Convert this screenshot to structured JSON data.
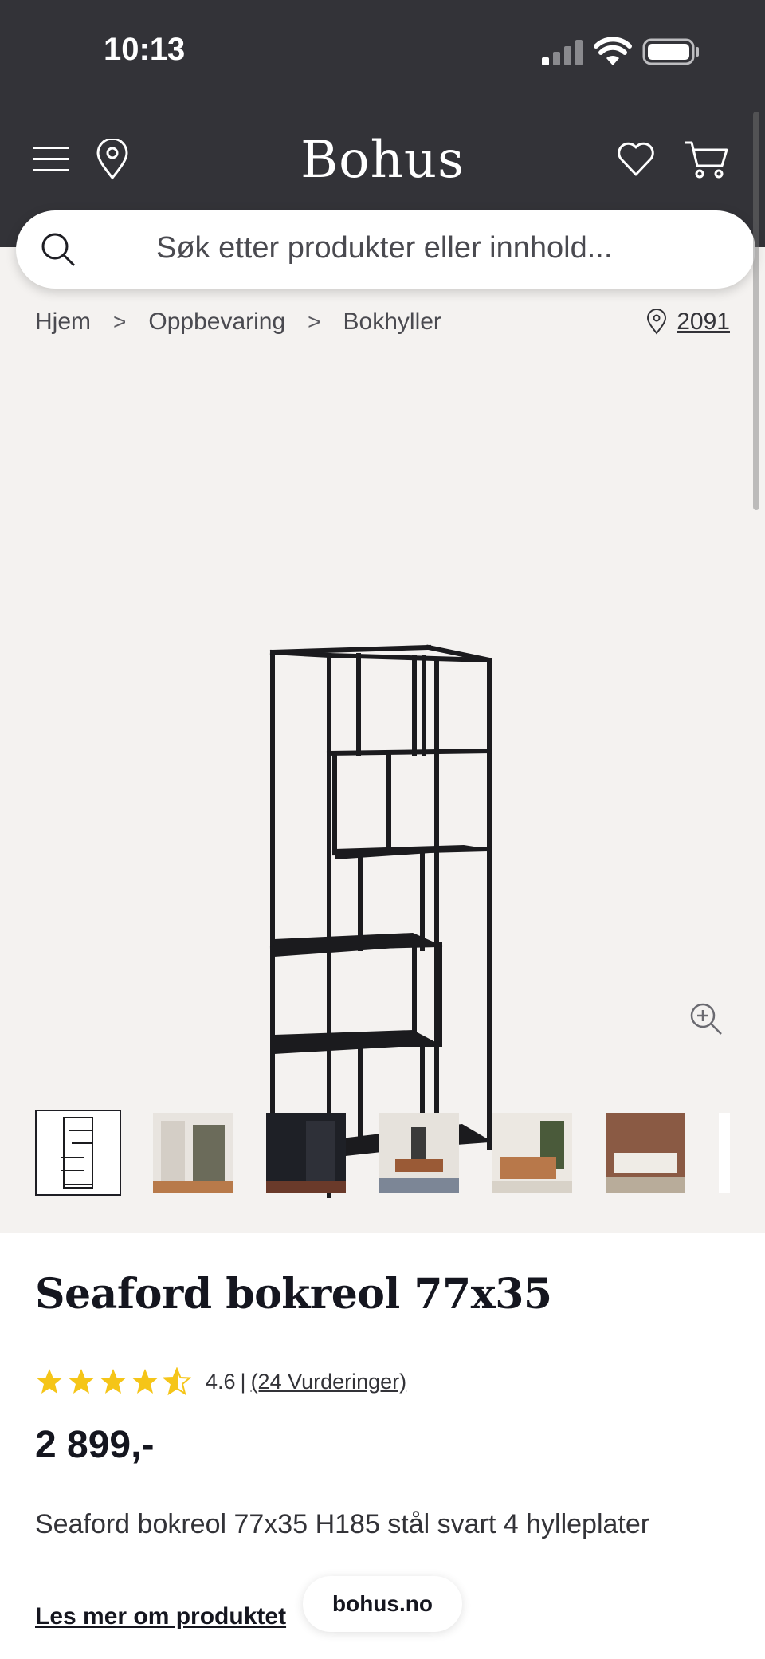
{
  "status_bar": {
    "time": "10:13"
  },
  "header": {
    "logo": "Bohus",
    "icons": [
      "menu-icon",
      "location-icon",
      "heart-icon",
      "cart-icon"
    ]
  },
  "search": {
    "placeholder": "Søk etter produkter eller innhold..."
  },
  "breadcrumb": {
    "items": [
      "Hjem",
      "Oppbevaring",
      "Bokhyller"
    ],
    "separator": ">"
  },
  "postcode": "2091",
  "gallery": {
    "thumbnail_count": 7,
    "active_index": 0
  },
  "product": {
    "title": "Seaford bokreol 77x35",
    "rating_value": "4.6",
    "rating_separator": "|",
    "rating_count": "(24 Vurderinger)",
    "stars": 4.6,
    "price": "2 899,-",
    "description": "Seaford bokreol 77x35 H185 stål svart 4 hylleplater",
    "read_more": "Les mer om produktet"
  },
  "browser": {
    "url": "bohus.no"
  },
  "colors": {
    "header_bg": "#333338",
    "gallery_bg": "#f4f2f0",
    "star": "#f5c518",
    "text": "#15161f"
  }
}
